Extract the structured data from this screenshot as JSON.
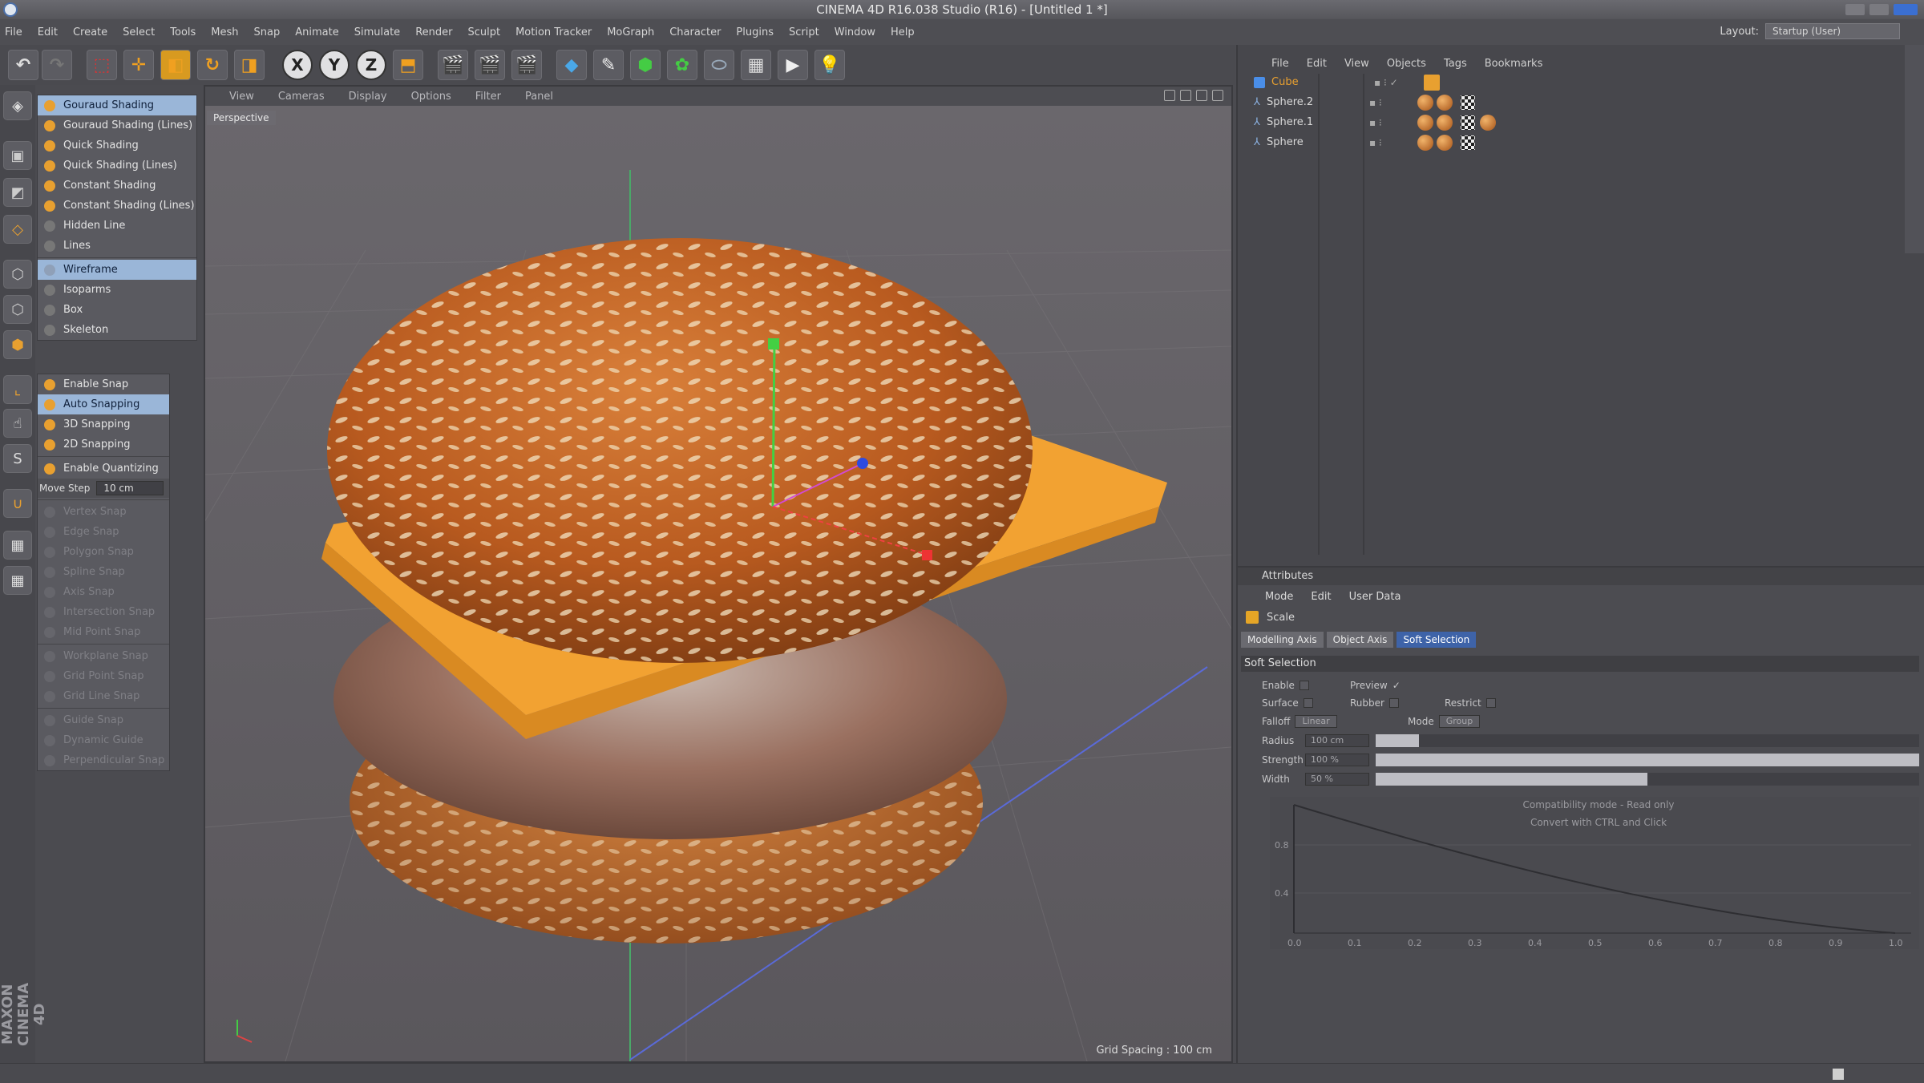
{
  "window": {
    "title": "CINEMA 4D R16.038 Studio (R16) - [Untitled 1 *]"
  },
  "menu": [
    "File",
    "Edit",
    "Create",
    "Select",
    "Tools",
    "Mesh",
    "Snap",
    "Animate",
    "Simulate",
    "Render",
    "Sculpt",
    "Motion Tracker",
    "MoGraph",
    "Character",
    "Plugins",
    "Script",
    "Window",
    "Help"
  ],
  "layout": {
    "label": "Layout:",
    "value": "Startup (User)"
  },
  "toolbar": {
    "axis_x": "X",
    "axis_y": "Y",
    "axis_z": "Z"
  },
  "shading_menu": [
    {
      "label": "Gouraud Shading",
      "state": "highlight"
    },
    {
      "label": "Gouraud Shading (Lines)",
      "state": "normal"
    },
    {
      "label": "Quick Shading",
      "state": "normal"
    },
    {
      "label": "Quick Shading (Lines)",
      "state": "normal"
    },
    {
      "label": "Constant Shading",
      "state": "normal"
    },
    {
      "label": "Constant Shading (Lines)",
      "state": "normal"
    },
    {
      "label": "Hidden Line",
      "state": "normal"
    },
    {
      "label": "Lines",
      "state": "normal"
    },
    {
      "label": "Wireframe",
      "state": "highlight"
    },
    {
      "label": "Isoparms",
      "state": "normal"
    },
    {
      "label": "Box",
      "state": "normal"
    },
    {
      "label": "Skeleton",
      "state": "normal"
    }
  ],
  "snap_menu": {
    "top": [
      {
        "label": "Enable Snap",
        "state": "normal"
      },
      {
        "label": "Auto Snapping",
        "state": "highlight"
      },
      {
        "label": "3D Snapping",
        "state": "normal"
      },
      {
        "label": "2D Snapping",
        "state": "normal"
      },
      {
        "label": "Enable Quantizing",
        "state": "normal"
      }
    ],
    "move_step_label": "Move Step",
    "move_step_value": "10 cm",
    "disabled": [
      "Vertex Snap",
      "Edge Snap",
      "Polygon Snap",
      "Spline Snap",
      "Axis Snap",
      "Intersection Snap",
      "Mid Point Snap",
      "Workplane Snap",
      "Grid Point Snap",
      "Grid Line Snap",
      "Guide Snap",
      "Dynamic Guide",
      "Perpendicular Snap"
    ]
  },
  "viewport": {
    "menu": [
      "View",
      "Cameras",
      "Display",
      "Options",
      "Filter",
      "Panel"
    ],
    "camera": "Perspective",
    "grid_spacing": "Grid Spacing : 100 cm"
  },
  "object_manager": {
    "menu": [
      "File",
      "Edit",
      "View",
      "Objects",
      "Tags",
      "Bookmarks"
    ],
    "objects": [
      {
        "name": "Cube",
        "color": "#e8a030"
      },
      {
        "name": "Sphere.2",
        "color": "#c8c8c8"
      },
      {
        "name": "Sphere.1",
        "color": "#c8c8c8"
      },
      {
        "name": "Sphere",
        "color": "#c8c8c8"
      }
    ]
  },
  "attributes": {
    "header": "Attributes",
    "menu": [
      "Mode",
      "Edit",
      "User Data"
    ],
    "object": "Scale",
    "tabs": [
      "Modelling Axis",
      "Object Axis",
      "Soft Selection"
    ],
    "section": "Soft Selection",
    "enable_label": "Enable",
    "preview_label": "Preview",
    "preview_mark": "✓",
    "surface_label": "Surface",
    "rubber_label": "Rubber",
    "restrict_label": "Restrict",
    "falloff_label": "Falloff",
    "falloff_value": "Linear",
    "mode_label": "Mode",
    "mode_value": "Group",
    "radius_label": "Radius",
    "radius_value": "100 cm",
    "radius_fill": 0.08,
    "strength_label": "Strength",
    "strength_value": "100 %",
    "strength_fill": 1.0,
    "width_label": "Width",
    "width_value": "50 %",
    "width_fill": 0.5,
    "curve_note_1": "Compatibility mode - Read only",
    "curve_note_2": "Convert with CTRL and Click",
    "curve_y_ticks": [
      "0.8",
      "0.4"
    ],
    "curve_x_ticks": [
      "0.0",
      "0.1",
      "0.2",
      "0.3",
      "0.4",
      "0.5",
      "0.6",
      "0.7",
      "0.8",
      "0.9",
      "1.0"
    ]
  },
  "colors": {
    "accent": "#3e63a8",
    "highlight": "#9ab6d8",
    "cheese": "#f2a232",
    "bun": "#c86b2a"
  }
}
